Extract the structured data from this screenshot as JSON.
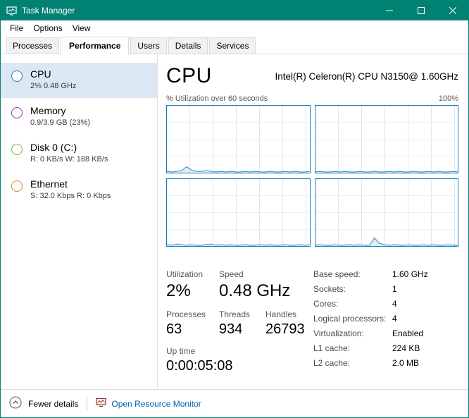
{
  "window": {
    "title": "Task Manager"
  },
  "colors": {
    "accent": "#008272",
    "link": "#0063B1",
    "sidebar_selected": "#dbe8f4"
  },
  "menu": {
    "items": [
      "File",
      "Options",
      "View"
    ]
  },
  "tabs": [
    {
      "label": "Processes",
      "active": false
    },
    {
      "label": "Performance",
      "active": true
    },
    {
      "label": "Users",
      "active": false
    },
    {
      "label": "Details",
      "active": false
    },
    {
      "label": "Services",
      "active": false
    }
  ],
  "sidebar": {
    "items": [
      {
        "name": "CPU",
        "detail": "2% 0.48 GHz",
        "color": "#2a78c0",
        "selected": true
      },
      {
        "name": "Memory",
        "detail": "0.9/3.9 GB (23%)",
        "color": "#a12bb8",
        "selected": false
      },
      {
        "name": "Disk 0 (C:)",
        "detail": "R: 0 KB/s W: 188 KB/s",
        "color": "#7cb52b",
        "selected": false
      },
      {
        "name": "Ethernet",
        "detail": "S: 32.0 Kbps R: 0 Kbps",
        "color": "#d3862c",
        "selected": false
      }
    ]
  },
  "main": {
    "title": "CPU",
    "subtitle": "Intel(R) Celeron(R) CPU N3150@ 1.60GHz",
    "graph": {
      "caption": "% Utilization over 60 seconds",
      "max_label": "100%",
      "border_color": "#117dbb",
      "line_color": "#3487c2",
      "fill_color": "rgba(52,135,194,0.14)"
    },
    "graphs": [
      {
        "points": [
          2,
          1,
          2,
          3,
          9,
          4,
          2,
          2,
          3,
          2,
          1,
          2,
          1,
          2,
          1,
          1,
          2,
          1,
          2,
          1,
          1,
          2,
          1,
          1,
          2,
          1,
          2,
          1,
          1,
          2
        ]
      },
      {
        "points": [
          1,
          2,
          1,
          1,
          2,
          1,
          2,
          1,
          1,
          2,
          1,
          1,
          2,
          1,
          1,
          2,
          1,
          2,
          1,
          1,
          2,
          1,
          1,
          2,
          1,
          2,
          1,
          1,
          2,
          1
        ]
      },
      {
        "points": [
          2,
          1,
          3,
          2,
          1,
          2,
          1,
          1,
          2,
          3,
          1,
          2,
          1,
          2,
          1,
          1,
          2,
          1,
          1,
          2,
          1,
          2,
          1,
          1,
          2,
          1,
          1,
          2,
          1,
          2
        ]
      },
      {
        "points": [
          1,
          2,
          1,
          1,
          2,
          1,
          1,
          2,
          1,
          2,
          1,
          1,
          12,
          4,
          2,
          1,
          2,
          1,
          1,
          2,
          1,
          1,
          2,
          1,
          2,
          1,
          1,
          2,
          1,
          1
        ]
      }
    ],
    "stats": {
      "utilization": {
        "label": "Utilization",
        "value": "2%"
      },
      "speed": {
        "label": "Speed",
        "value": "0.48 GHz"
      },
      "processes": {
        "label": "Processes",
        "value": "63"
      },
      "threads": {
        "label": "Threads",
        "value": "934"
      },
      "handles": {
        "label": "Handles",
        "value": "26793"
      },
      "uptime": {
        "label": "Up time",
        "value": "0:00:05:08"
      }
    },
    "specs": [
      {
        "label": "Base speed:",
        "value": "1.60 GHz"
      },
      {
        "label": "Sockets:",
        "value": "1"
      },
      {
        "label": "Cores:",
        "value": "4"
      },
      {
        "label": "Logical processors:",
        "value": "4"
      },
      {
        "label": "Virtualization:",
        "value": "Enabled"
      },
      {
        "label": "L1 cache:",
        "value": "224 KB"
      },
      {
        "label": "L2 cache:",
        "value": "2.0 MB"
      }
    ]
  },
  "footer": {
    "fewer_details": "Fewer details",
    "resource_monitor": "Open Resource Monitor"
  }
}
